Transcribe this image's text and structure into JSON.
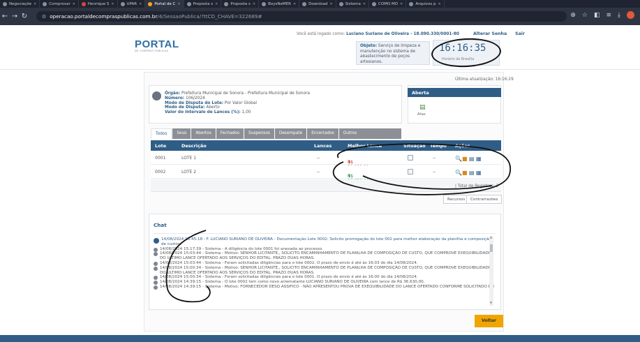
{
  "browser": {
    "tabs": [
      {
        "label": "Negociaçõe"
      },
      {
        "label": "Comprovar"
      },
      {
        "label": "Henrique S"
      },
      {
        "label": "UPAR"
      },
      {
        "label": "Portal de C",
        "active": true
      },
      {
        "label": "Proposta s"
      },
      {
        "label": "Proposta s"
      },
      {
        "label": "BoysNeMER"
      },
      {
        "label": "Download"
      },
      {
        "label": "Sistema"
      },
      {
        "label": "COMO MO"
      },
      {
        "label": "Arquivos p"
      }
    ],
    "url_host": "operacao.portaldecompraspublicas.com.br",
    "url_path": "/4/SessaoPublica/?ttCD_CHAVE=322689#"
  },
  "header": {
    "logo_main": "PORTAL",
    "logo_sub": "DE COMPRAS PÚBLICAS",
    "logged_prefix": "Você está logado como:",
    "logged_user": "Luciano Suriano de Oliveira - 18.090.330/0001-80",
    "alterar_senha": "Alterar Senha",
    "sair": "Sair",
    "objeto_label": "Objeto:",
    "objeto_text": "Serviço de limpeza e manutenção no sistema de abastecimento de poços artesianos.",
    "clock_time": "16:16:35",
    "clock_label": "Horário de Brasília"
  },
  "process": {
    "last_update": "Última atualização: 16:16:29",
    "orgao_label": "Órgão:",
    "orgao": "Prefeitura Municipal de Sonora - Prefeitura Municipal de Sonora",
    "numero_label": "Número:",
    "numero": "106/2024",
    "modo_lote_label": "Modo de Disputa do Lote:",
    "modo_lote": "Por Valor Global",
    "modo_label": "Modo de Disputa:",
    "modo": "Aberto",
    "intervalo_label": "Valor do Intervalo de Lances (%):",
    "intervalo": "1,00",
    "status": "Aberta",
    "atas_label": "Atas"
  },
  "filter_tabs": [
    "Todos",
    "Seus",
    "Abertos",
    "Fechados",
    "Suspensos",
    "Desempate",
    "Encerrados",
    "Outros"
  ],
  "table": {
    "headers": [
      "Lote",
      "Descrição",
      "Lances",
      "Melhor Lance",
      "Situação",
      "Tempo",
      "Ações"
    ],
    "rows": [
      {
        "lote": "0001",
        "descricao": "LOTE 1",
        "lances": "--",
        "melhor_lance": "R$ 50.000,00",
        "tempo": "--",
        "trend": "down"
      },
      {
        "lote": "0002",
        "descricao": "LOTE 2",
        "lances": "--",
        "melhor_lance": "R$ 36.630,00",
        "tempo": "--",
        "trend": "up"
      }
    ],
    "total": "| Total de Registros: 2",
    "recursos": "Recursos",
    "contrarrazoes": "Contrarrazões"
  },
  "chat": {
    "title": "Chat",
    "messages": [
      "14/08/2024 15:45:18 - F. LUCIANO SURIANO DE OLIVEIRA - Documentação Lote 0002: Solicito prorrogação do lote 002 para melhor elaboração da planilha e composição de custos.",
      "14/08/2024 15:17:39 - Sistema - A diligência do lote 0001 foi anexada ao processo.",
      "14/08/2024 15:03:44 - Sistema - Motivo: SENHOR LICITANTE,, SOLICITO ENCAMINHAMENTO DE PLANILHA DE COMPOSIÇÃO DE CUSTO, QUE COMPROVE EXEQUIBILIDADE DO ULTIMO LANCE OFERTADO AOS SERVIÇOS DO EDITAL. PRAZO DUAS HORAS.",
      "14/08/2024 15:03:44 - Sistema - Foram solicitadas diligências para o lote 0002. O prazo de envio é até às 16:03 do dia 14/08/2024.",
      "14/08/2024 15:00:34 - Sistema - Motivo: SENHOR LICITANTE,, SOLICITO ENCAMINHAMENTO DE PLANILHA DE COMPOSIÇÃO DE CUSTO, QUE COMPROVE EXEQUIBILIDADE DO ULTIMO LANCE OFERTADO AOS SERVIÇOS DO EDITAL. PRAZO DUAS HORAS.",
      "14/08/2024 15:00:34 - Sistema - Foram solicitadas diligências para o lote 0001. O prazo de envio é até às 16:00 do dia 14/08/2024.",
      "14/08/2024 14:39:15 - Sistema - O lote 0002 tem como novo arrematante LUCIANO SURIANO DE OLIVEIRA com lance de R$ 36.630,00.",
      "14/08/2024 14:39:15 - Sistema - Motivo: FORNECEDOR DESQ ASSIFICO - NÃO APRESENTOU PROVA DE EXEQUIBILIDADE DO LANCE OFERTADO CONFORME SOLICITADO EM"
    ]
  },
  "voltar": "Voltar",
  "colors": {
    "primary": "#2f5d86",
    "accent": "#f0a500",
    "red": "#c0392b",
    "green": "#2e8b3e"
  }
}
